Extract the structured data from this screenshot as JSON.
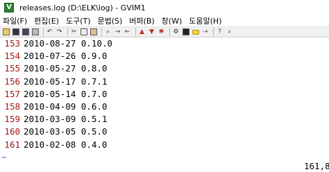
{
  "window": {
    "title": "releases.log (D:\\ELK\\log) - GVIM1"
  },
  "menu": [
    "파일(F)",
    "편집(E)",
    "도구(T)",
    "문법(S)",
    "버퍼(B)",
    "창(W)",
    "도움말(H)"
  ],
  "toolbar_icons": [
    "open-icon",
    "save-icon",
    "save-all-icon",
    "print-icon",
    "undo-icon",
    "redo-icon",
    "cut-icon",
    "copy-icon",
    "paste-icon",
    "find-icon",
    "find-next-icon",
    "find-prev-icon",
    "load-session-icon",
    "save-session-icon",
    "run-script-icon",
    "make-icon",
    "shell-icon",
    "make-tags-icon",
    "jump-tag-icon",
    "help-icon",
    "find-help-icon"
  ],
  "editor": {
    "lines": [
      {
        "num": "153",
        "text": "2010-08-27 0.10.0"
      },
      {
        "num": "154",
        "text": "2010-07-26 0.9.0"
      },
      {
        "num": "155",
        "text": "2010-05-27 0.8.0"
      },
      {
        "num": "156",
        "text": "2010-05-17 0.7.1"
      },
      {
        "num": "157",
        "text": "2010-05-14 0.7.0"
      },
      {
        "num": "158",
        "text": "2010-04-09 0.6.0"
      },
      {
        "num": "159",
        "text": "2010-03-09 0.5.1"
      },
      {
        "num": "160",
        "text": "2010-03-05 0.5.0"
      },
      {
        "num": "161",
        "text": "2010-02-08 0.4.0"
      }
    ],
    "tilde": "~"
  },
  "status": {
    "ruler": "161,8"
  }
}
